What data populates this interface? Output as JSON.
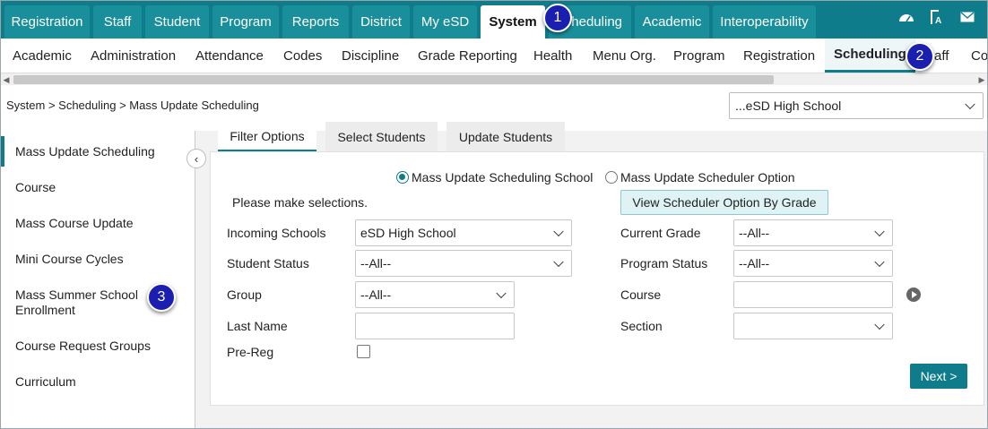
{
  "top_nav": {
    "tabs": [
      {
        "label": "Registration"
      },
      {
        "label": "Staff"
      },
      {
        "label": "Student"
      },
      {
        "label": "Program"
      },
      {
        "label": "Reports"
      },
      {
        "label": "District"
      },
      {
        "label": "My eSD"
      },
      {
        "label": "System",
        "active": true
      },
      {
        "label": "heduling"
      },
      {
        "label": "Academic"
      },
      {
        "label": "Interoperability"
      }
    ],
    "icons": [
      "dashboard-icon",
      "font-icon",
      "mail-icon"
    ]
  },
  "sub_nav": {
    "tabs": [
      {
        "label": "Academic"
      },
      {
        "label": "Administration"
      },
      {
        "label": "Attendance"
      },
      {
        "label": "Codes"
      },
      {
        "label": "Discipline"
      },
      {
        "label": "Grade Reporting"
      },
      {
        "label": "Health"
      },
      {
        "label": "Menu Org."
      },
      {
        "label": "Program"
      },
      {
        "label": "Registration"
      },
      {
        "label": "Scheduling",
        "active": true
      },
      {
        "label": "aff"
      },
      {
        "label": "Co"
      }
    ]
  },
  "breadcrumb": "System > Scheduling > Mass Update Scheduling",
  "school_select": "...eSD High School",
  "sidebar": {
    "items": [
      {
        "label": "Mass Update Scheduling",
        "active": true
      },
      {
        "label": "Course"
      },
      {
        "label": "Mass Course Update"
      },
      {
        "label": "Mini Course Cycles"
      },
      {
        "label": "Mass Summer School Enrollment"
      },
      {
        "label": "Course Request Groups"
      },
      {
        "label": "Curriculum"
      }
    ]
  },
  "content_tabs": [
    {
      "label": "Filter Options",
      "active": true
    },
    {
      "label": "Select Students"
    },
    {
      "label": "Update Students"
    }
  ],
  "form": {
    "radio_school": "Mass Update Scheduling School",
    "radio_option": "Mass Update Scheduler Option",
    "instructions": "Please make selections.",
    "view_button": "View Scheduler Option By Grade",
    "incoming_schools_label": "Incoming Schools",
    "incoming_schools_value": "eSD High School",
    "student_status_label": "Student Status",
    "student_status_value": "--All--",
    "group_label": "Group",
    "group_value": "--All--",
    "last_name_label": "Last Name",
    "pre_reg_label": "Pre-Reg",
    "current_grade_label": "Current Grade",
    "current_grade_value": "--All--",
    "program_status_label": "Program Status",
    "program_status_value": "--All--",
    "course_label": "Course",
    "section_label": "Section",
    "next_button": "Next >"
  },
  "badges": [
    "1",
    "2",
    "3"
  ],
  "colors": {
    "brand": "#0e7c8a",
    "badge": "#1a1fb0"
  }
}
